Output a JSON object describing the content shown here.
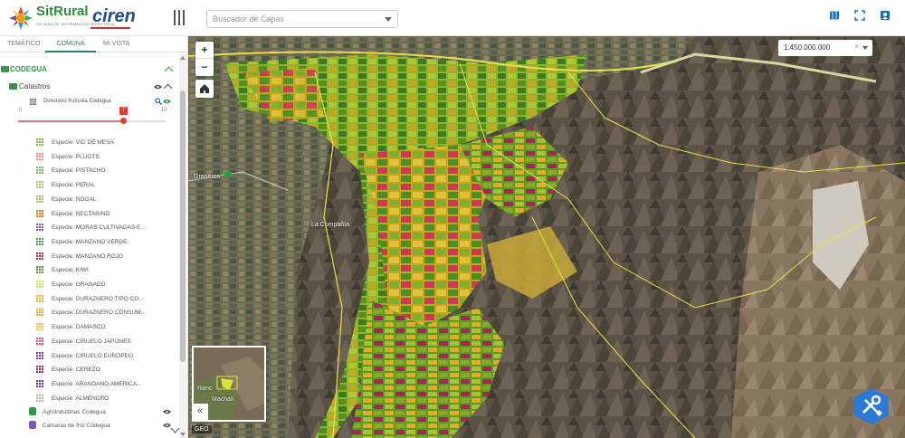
{
  "header": {
    "brand_name": "SitRural",
    "brand_tagline": "SISTEMA DE INFORMACIÓN TERRITORIAL",
    "partner_name": "ciren",
    "search_placeholder": "Buscador de Capas",
    "accent_color": "#2e9b46"
  },
  "sidebar": {
    "tabs": [
      {
        "label": "TEMÁTICO"
      },
      {
        "label": "COMUNA"
      },
      {
        "label": "MI VISTA"
      }
    ],
    "group_title": "CODEGUA",
    "subgroup_title": "Catastros",
    "layer_title": "Directorio frutícola Codegua",
    "slider": {
      "min": "0",
      "max": "10",
      "value": "7"
    },
    "species": [
      {
        "label": "Especie: VID DE MESA",
        "color": "#7cb342"
      },
      {
        "label": "Especie: PLUOTS",
        "color": "#ff8a65"
      },
      {
        "label": "Especie: PISTACHO",
        "color": "#66bb6a"
      },
      {
        "label": "Especie: PERAL",
        "color": "#9ccc65"
      },
      {
        "label": "Especie: NOGAL",
        "color": "#d4a66a"
      },
      {
        "label": "Especie: NECTARINO",
        "color": "#ef6c00"
      },
      {
        "label": "Especie: MORAS CULTIVADAS E...",
        "color": "#7e57c2"
      },
      {
        "label": "Especie: MANZANO VERDE",
        "color": "#43a047"
      },
      {
        "label": "Especie: MANZANO ROJO",
        "color": "#c62828"
      },
      {
        "label": "Especie: KIWI",
        "color": "#558b2f"
      },
      {
        "label": "Especie: GRANADO",
        "color": "#d4e157"
      },
      {
        "label": "Especie: DURAZNERO TIPO CO...",
        "color": "#ffa726"
      },
      {
        "label": "Especie: DURAZNERO CONSUM...",
        "color": "#f9a825"
      },
      {
        "label": "Especie: DAMASCO",
        "color": "#fbc02d"
      },
      {
        "label": "Especie: CIRUELO JAPONES",
        "color": "#ec407a"
      },
      {
        "label": "Especie: CIRUELO EUROPEO",
        "color": "#8e24aa"
      },
      {
        "label": "Especie: CEREZO",
        "color": "#ad1457"
      },
      {
        "label": "Especie: ARANDANO AMERICA...",
        "color": "#5e35b1"
      },
      {
        "label": "Especie: ALMENDRO",
        "color": "#bcaaa4"
      }
    ],
    "extra_layers": [
      {
        "label": "Agroindustrias Codegua",
        "color": "#2e9b46"
      },
      {
        "label": "Camaras de frío Codegua",
        "color": "#7e57c2"
      }
    ]
  },
  "map": {
    "scale_value": "1:450.000.000",
    "overview_labels": [
      "Ranc",
      "Machalí"
    ],
    "attribution": "GEO",
    "place_labels": [
      "Graneros",
      "La Compañía"
    ]
  }
}
